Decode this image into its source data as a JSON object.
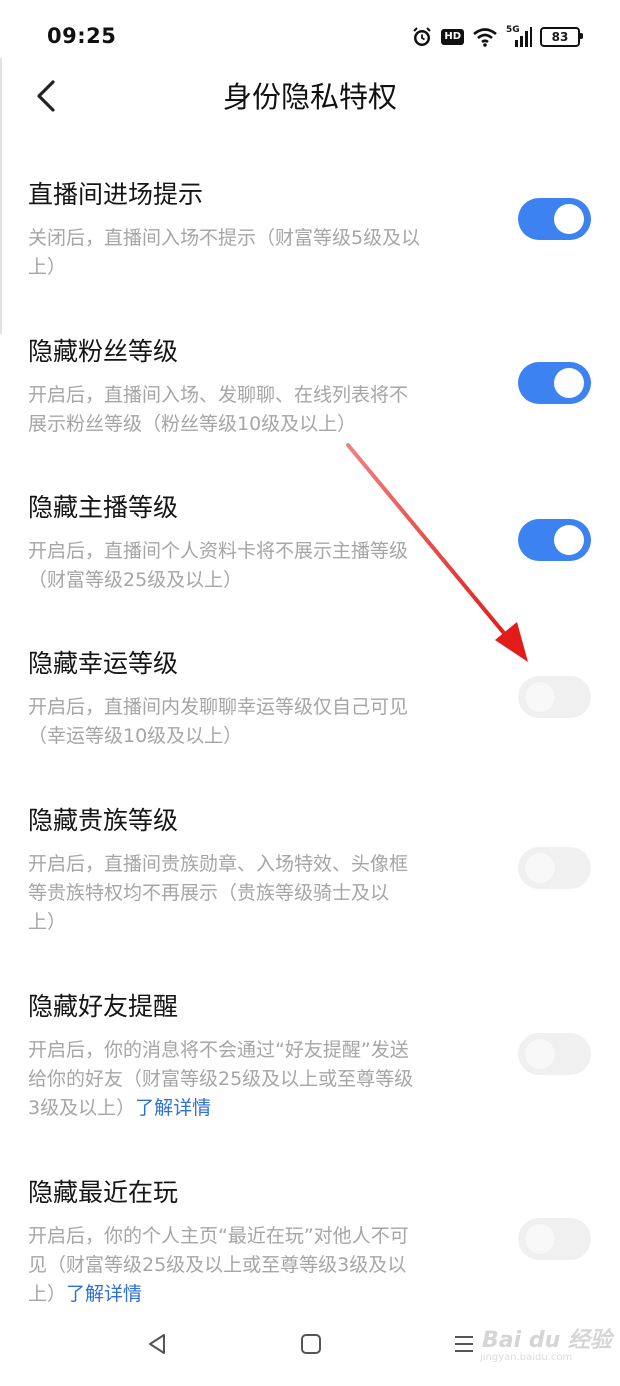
{
  "status_bar": {
    "time": "09:25",
    "icons": [
      "alarm-icon",
      "hd-icon",
      "wifi-icon",
      "cellular-5g-icon",
      "battery-icon"
    ],
    "hd_label": "HD",
    "network_label": "5G",
    "battery_level": "83"
  },
  "header": {
    "back_icon": "chevron-left-icon",
    "title": "身份隐私特权"
  },
  "settings": {
    "items": [
      {
        "title": "直播间进场提示",
        "desc_lines": [
          "关闭后，直播间入场不提示（财富等级5级及以",
          "上）"
        ],
        "enabled": true
      },
      {
        "title": "隐藏粉丝等级",
        "desc_lines": [
          "开启后，直播间入场、发聊聊、在线列表将不",
          "展示粉丝等级（粉丝等级10级及以上）"
        ],
        "enabled": true
      },
      {
        "title": "隐藏主播等级",
        "desc_lines": [
          "开启后，直播间个人资料卡将不展示主播等级",
          "（财富等级25级及以上）"
        ],
        "enabled": true
      },
      {
        "title": "隐藏幸运等级",
        "desc_lines": [
          "开启后，直播间内发聊聊幸运等级仅自己可见",
          "（幸运等级10级及以上）"
        ],
        "enabled": false
      },
      {
        "title": "隐藏贵族等级",
        "desc_lines": [
          "开启后，直播间贵族勋章、入场特效、头像框",
          "等贵族特权均不再展示（贵族等级骑士及以",
          "上）"
        ],
        "enabled": false
      },
      {
        "title": "隐藏好友提醒",
        "desc_lines": [
          "开启后，你的消息将不会通过“好友提醒”发送",
          "给你的好友（财富等级25级及以上或至尊等级",
          "3级及以上）"
        ],
        "link": "了解详情",
        "enabled": false
      },
      {
        "title": "隐藏最近在玩",
        "desc_lines": [
          "开启后，你的个人主页“最近在玩”对他人不可",
          "见（财富等级25级及以上或至尊等级3级及以",
          "上）"
        ],
        "link": "了解详情",
        "enabled": false
      }
    ]
  },
  "nav_bar": {
    "icons": [
      "back-triangle-icon",
      "home-square-icon",
      "menu-lines-icon"
    ]
  },
  "colors": {
    "toggle_on": "#3c82f0",
    "toggle_off": "#f0f0f0",
    "link": "#2f6fd6",
    "arrow": "#e21b1b"
  },
  "watermark": {
    "text": "Bai du 经验",
    "sub": "jingyan.baidu.com"
  }
}
